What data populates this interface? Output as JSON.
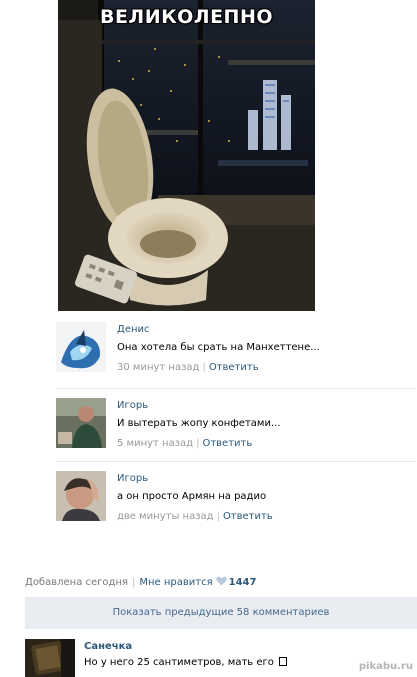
{
  "post": {
    "photo_caption": "ВЕЛИКОЛЕПНО",
    "added": "Добавлена сегодня",
    "like_label": "Мне нравится",
    "like_count": "1447"
  },
  "comments": [
    {
      "name": "Денис",
      "text": "Она хотела бы срать на Манхеттене...",
      "time": "30 минут назад",
      "reply": "Ответить"
    },
    {
      "name": "Игорь",
      "text": "И вытерать жопу конфетами...",
      "time": "5 минут назад",
      "reply": "Ответить"
    },
    {
      "name": "Игорь",
      "text": "а он просто Армян на радио",
      "time": "две минуты назад",
      "reply": "Ответить"
    }
  ],
  "show_previous": "Показать предыдущие 58 комментариев",
  "last_comment": {
    "name": "Санечка",
    "text": "Но у него 25 сантиметров, мать его"
  },
  "watermark": "pikabu.ru",
  "colors": {
    "link": "#2b587a",
    "meta": "#999999",
    "show_prev_bg": "#e9edf1"
  }
}
